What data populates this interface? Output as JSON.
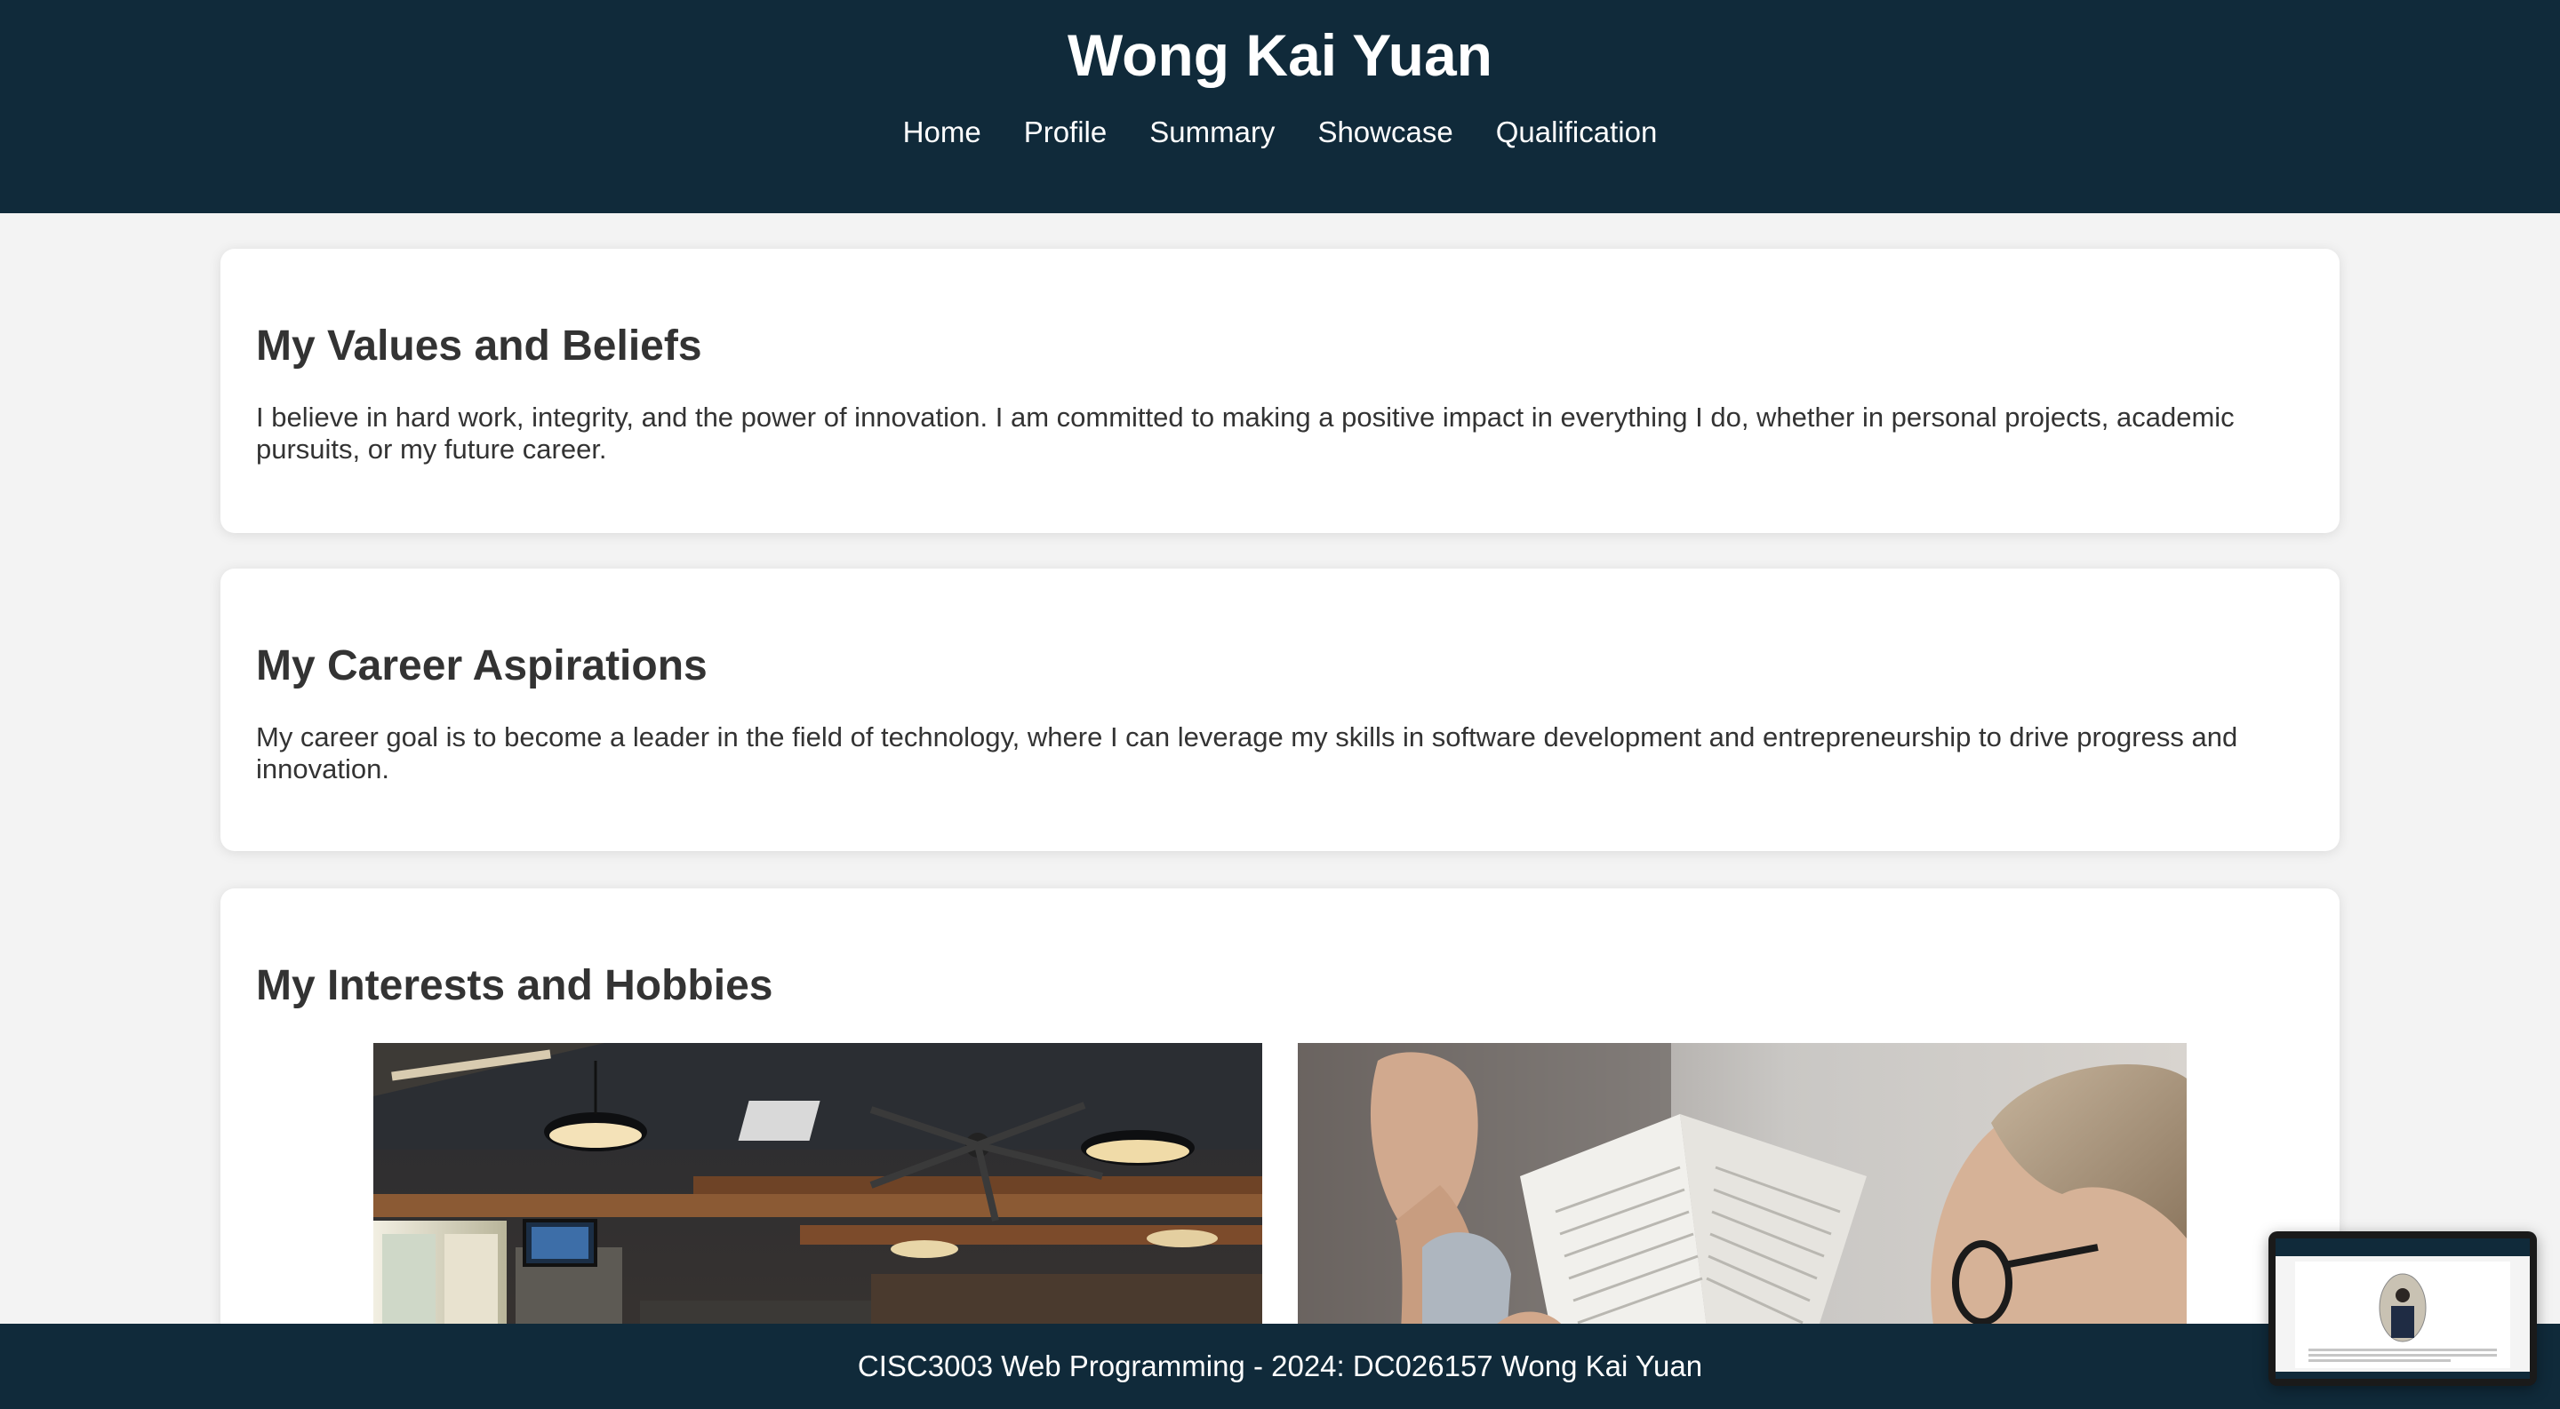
{
  "header": {
    "title": "Wong Kai Yuan",
    "nav": [
      "Home",
      "Profile",
      "Summary",
      "Showcase",
      "Qualification"
    ]
  },
  "sections": {
    "values": {
      "heading": "My Values and Beliefs",
      "text": "I believe in hard work, integrity, and the power of innovation. I am committed to making a positive impact in everything I do, whether in personal projects, academic pursuits, or my future career."
    },
    "career": {
      "heading": "My Career Aspirations",
      "text": "My career goal is to become a leader in the field of technology, where I can leverage my skills in software development and entrepreneurship to drive progress and innovation."
    },
    "interests": {
      "heading": "My Interests and Hobbies"
    }
  },
  "footer": {
    "text": "CISC3003 Web Programming - 2024: DC026157 Wong Kai Yuan"
  },
  "colors": {
    "header_bg": "#102a3a",
    "page_bg": "#f3f3f3",
    "card_bg": "#ffffff",
    "text": "#333333"
  }
}
